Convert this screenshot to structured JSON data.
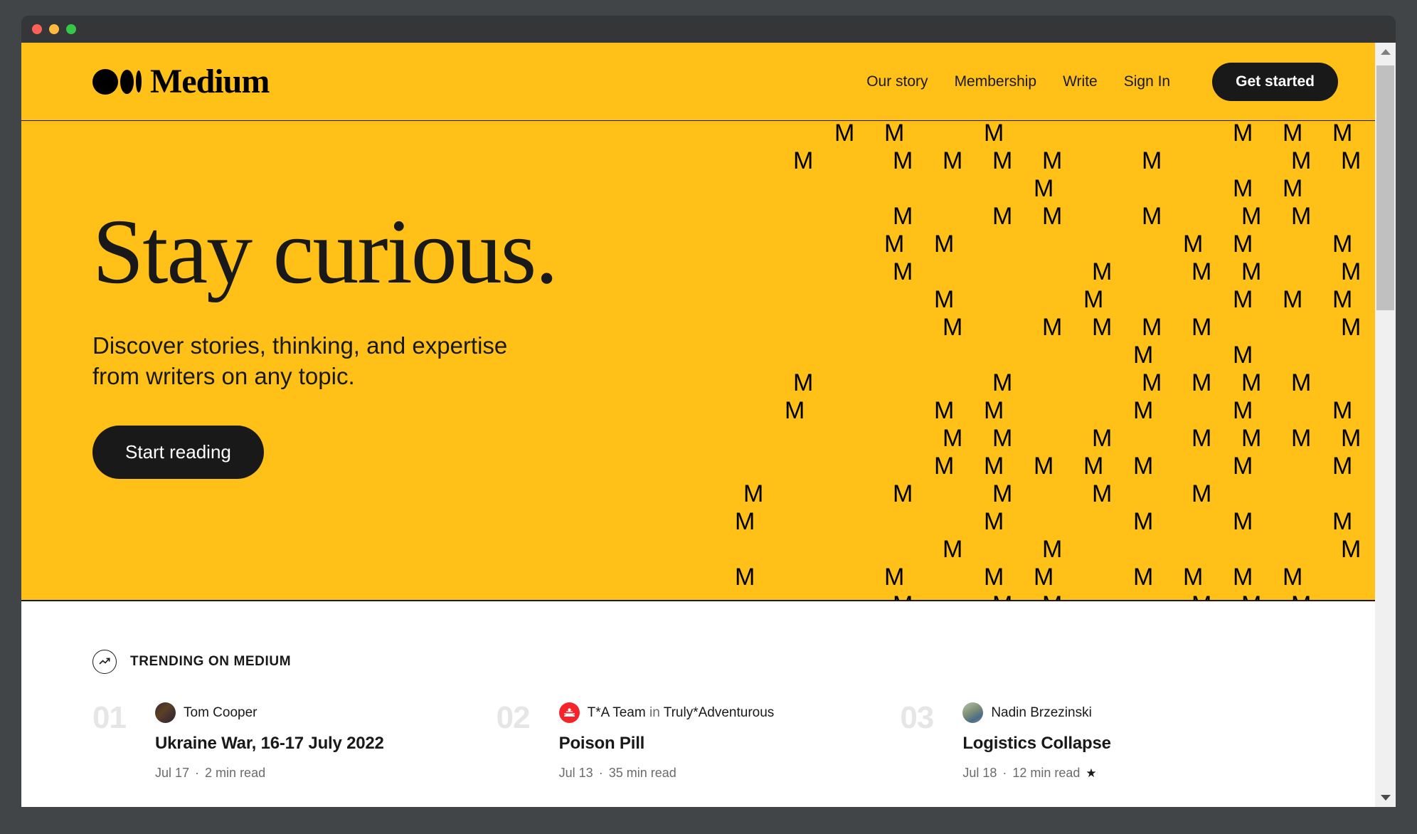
{
  "window": {
    "traffic_lights": [
      "close",
      "minimize",
      "zoom"
    ],
    "colors": {
      "close": "#FC6058",
      "minimize": "#FDBC40",
      "zoom": "#34C749",
      "titlebar": "#343637"
    }
  },
  "theme": {
    "brand_yellow": "#FFC017",
    "ink": "#191919",
    "muted": "#6B6B6B",
    "rank_gray": "#E6E6E6"
  },
  "header": {
    "logo_text": "Medium",
    "nav": [
      {
        "label": "Our story"
      },
      {
        "label": "Membership"
      },
      {
        "label": "Write"
      },
      {
        "label": "Sign In"
      }
    ],
    "cta_label": "Get started"
  },
  "hero": {
    "title": "Stay curious.",
    "subtitle_line1": "Discover stories, thinking, and expertise",
    "subtitle_line2": "from writers on any topic.",
    "cta_label": "Start reading",
    "pattern_glyph": "M"
  },
  "trending": {
    "icon": "trending-up-icon",
    "label": "TRENDING ON MEDIUM",
    "cards": [
      {
        "rank": "01",
        "author": "Tom Cooper",
        "publication": "",
        "in_word": "",
        "title": "Ukraine War, 16-17 July 2022",
        "date": "Jul 17",
        "separator": "·",
        "read_time": "2 min read",
        "member_star": ""
      },
      {
        "rank": "02",
        "author": "T*A Team",
        "in_word": "in",
        "publication": "Truly*Adventurous",
        "title": "Poison Pill",
        "date": "Jul 13",
        "separator": "·",
        "read_time": "35 min read",
        "member_star": ""
      },
      {
        "rank": "03",
        "author": "Nadin Brzezinski",
        "publication": "",
        "in_word": "",
        "title": "Logistics Collapse",
        "date": "Jul 18",
        "separator": "·",
        "read_time": "12 min read",
        "member_star": "★"
      }
    ]
  },
  "scrollbar": {
    "up_arrow": "chevron-up-icon",
    "down_arrow": "chevron-down-icon",
    "thumb": "scroll-thumb"
  }
}
